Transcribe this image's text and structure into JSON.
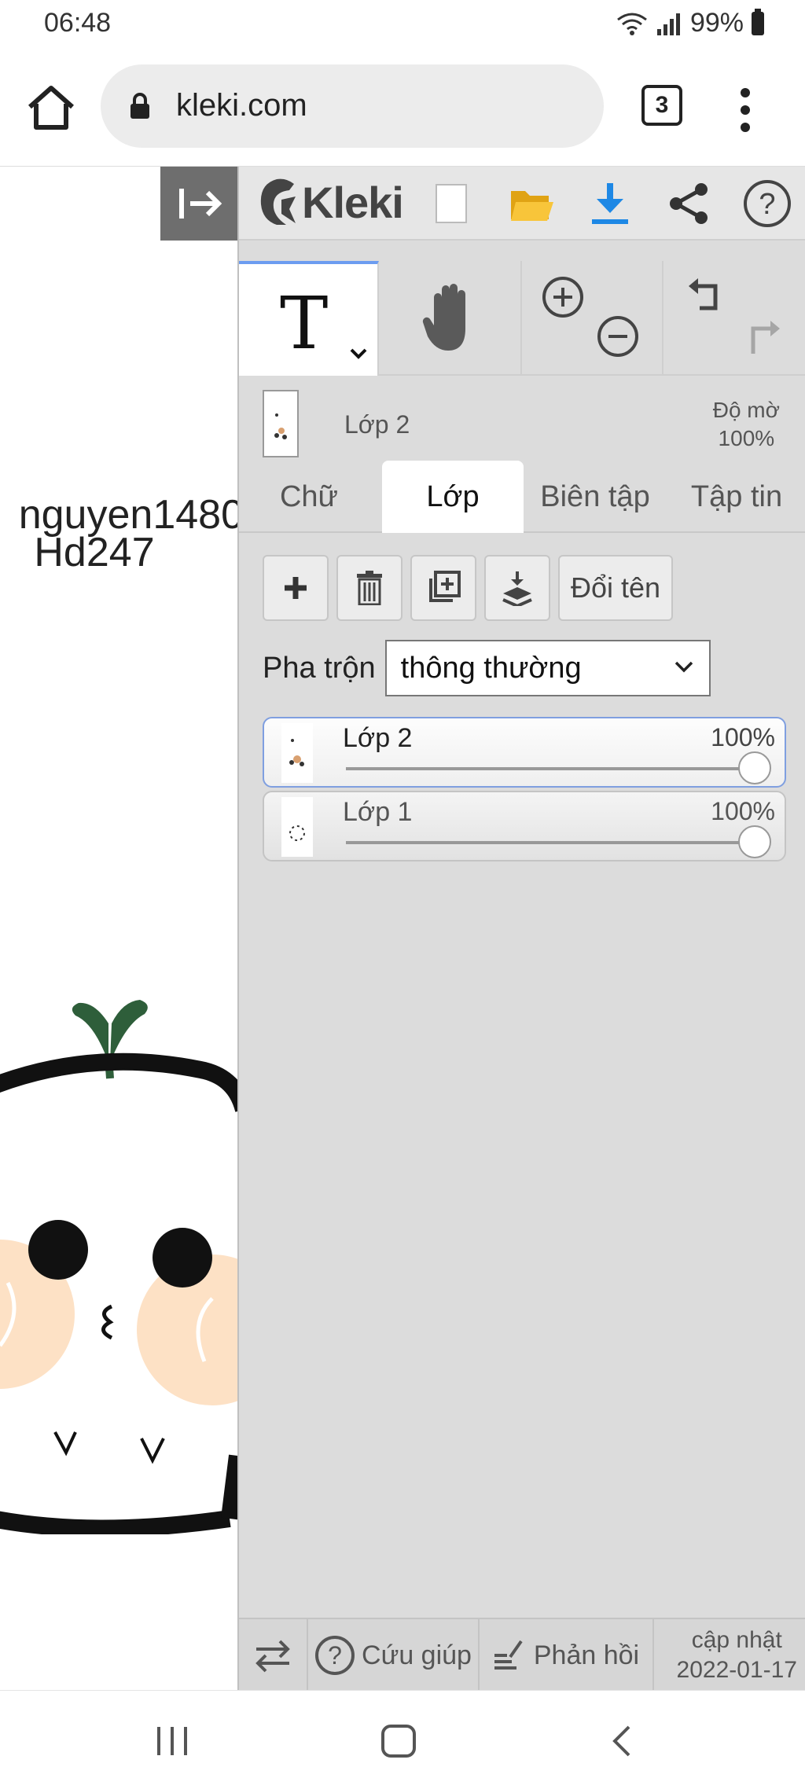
{
  "status": {
    "time": "06:48",
    "battery": "99%"
  },
  "browser": {
    "url": "kleki.com",
    "tab_count": "3"
  },
  "canvas": {
    "text_line1": "nguyen1480",
    "text_line2": "Hd247"
  },
  "app": {
    "name": "Kleki"
  },
  "layer_preview": {
    "name": "Lớp 2",
    "opacity_label": "Độ mờ",
    "opacity_value": "100%"
  },
  "tabs": [
    "Chữ",
    "Lớp",
    "Biên tập",
    "Tập tin"
  ],
  "layer_actions": {
    "rename": "Đổi tên"
  },
  "blend": {
    "label": "Pha trộn",
    "value": "thông thường"
  },
  "layers": [
    {
      "name": "Lớp 2",
      "opacity": "100%",
      "opacity_value": 1.0,
      "selected": true
    },
    {
      "name": "Lớp 1",
      "opacity": "100%",
      "opacity_value": 1.0,
      "selected": false
    }
  ],
  "bottom": {
    "help": "Cứu giúp",
    "feedback": "Phản hồi",
    "update_label": "cập nhật",
    "update_date": "2022-01-17"
  },
  "colors": {
    "accent": "#1e88e5",
    "folder": "#f2b51b",
    "panel_bg": "#dcdcdc",
    "selected_border": "#7f9fe0"
  }
}
